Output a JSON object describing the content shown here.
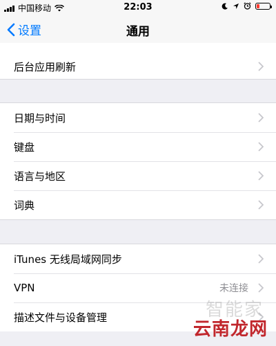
{
  "status_bar": {
    "carrier": "中国移动",
    "time": "22:03",
    "battery_level": 0.2
  },
  "nav": {
    "back_label": "设置",
    "title": "通用"
  },
  "groups": [
    {
      "items": [
        {
          "label": "后台应用刷新",
          "value": ""
        }
      ]
    },
    {
      "items": [
        {
          "label": "日期与时间",
          "value": ""
        },
        {
          "label": "键盘",
          "value": ""
        },
        {
          "label": "语言与地区",
          "value": ""
        },
        {
          "label": "词典",
          "value": ""
        }
      ]
    },
    {
      "items": [
        {
          "label": "iTunes 无线局域网同步",
          "value": ""
        },
        {
          "label": "VPN",
          "value": "未连接"
        },
        {
          "label": "描述文件与设备管理",
          "value": ""
        }
      ]
    }
  ],
  "watermark": {
    "text": "云南龙网",
    "faint_text": "智能家"
  },
  "colors": {
    "accent": "#007aff",
    "background": "#efeff4",
    "watermark": "#c1272d"
  }
}
